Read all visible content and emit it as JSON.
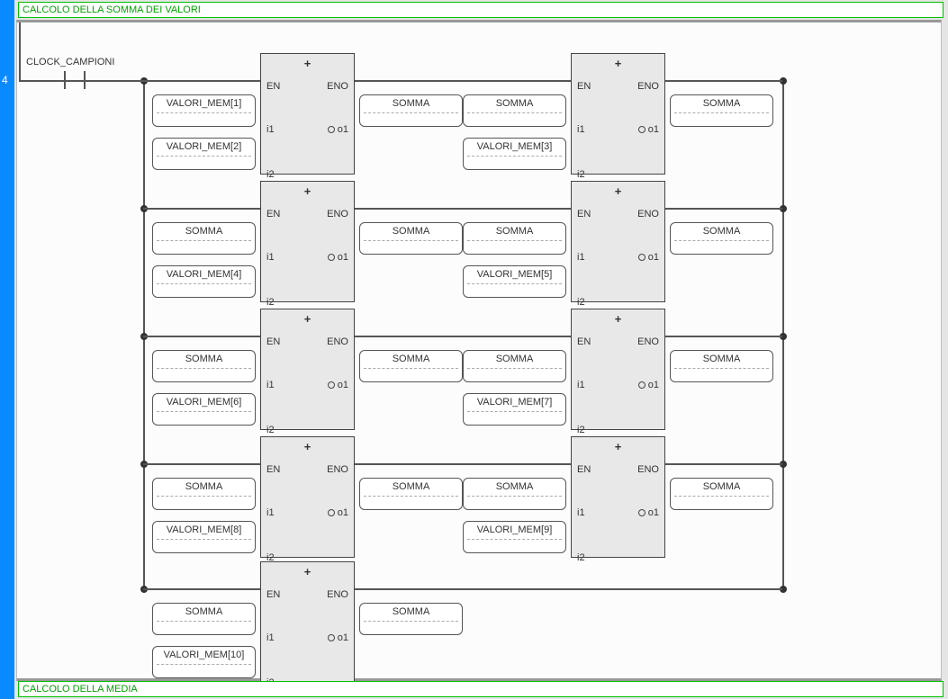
{
  "rung_number": "4",
  "comment_top": "CALCOLO DELLA SOMMA DEI VALORI",
  "comment_bottom": "CALCOLO DELLA MEDIA",
  "contact_label": "CLOCK_CAMPIONI",
  "fb": {
    "op": "+",
    "EN": "EN",
    "ENO": "ENO",
    "i1": "i1",
    "i2": "i2",
    "o1": "o1"
  },
  "vars": {
    "somma": "SOMMA",
    "vm1": "VALORI_MEM[1]",
    "vm2": "VALORI_MEM[2]",
    "vm3": "VALORI_MEM[3]",
    "vm4": "VALORI_MEM[4]",
    "vm5": "VALORI_MEM[5]",
    "vm6": "VALORI_MEM[6]",
    "vm7": "VALORI_MEM[7]",
    "vm8": "VALORI_MEM[8]",
    "vm9": "VALORI_MEM[9]",
    "vm10": "VALORI_MEM[10]"
  }
}
